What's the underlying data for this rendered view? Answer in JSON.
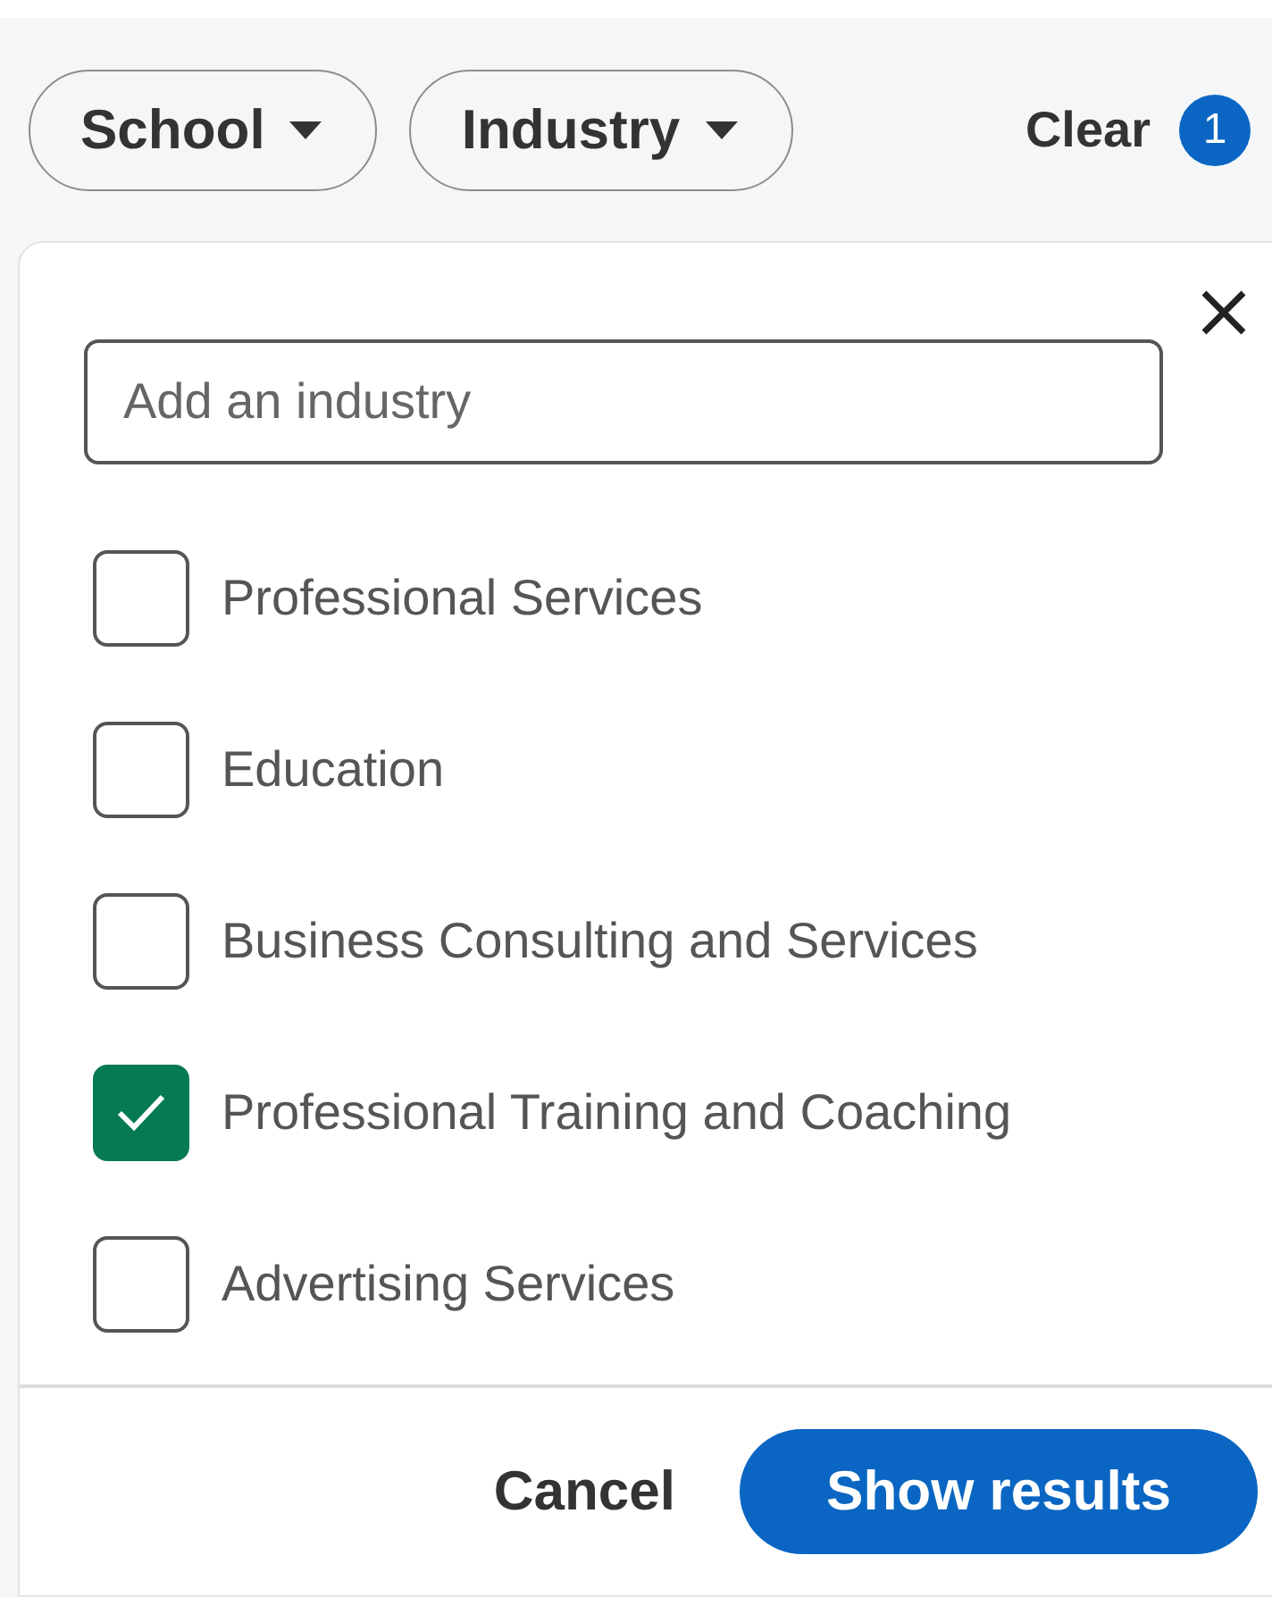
{
  "filters": [
    {
      "label": "School"
    },
    {
      "label": "Industry"
    }
  ],
  "clear": {
    "label": "Clear",
    "count": "1"
  },
  "panel": {
    "search": {
      "placeholder": "Add an industry"
    },
    "options": [
      {
        "label": "Professional Services",
        "checked": false
      },
      {
        "label": "Education",
        "checked": false
      },
      {
        "label": "Business Consulting and Services",
        "checked": false
      },
      {
        "label": "Professional Training and Coaching",
        "checked": true
      },
      {
        "label": "Advertising Services",
        "checked": false
      }
    ],
    "cancel": "Cancel",
    "submit": "Show results"
  }
}
